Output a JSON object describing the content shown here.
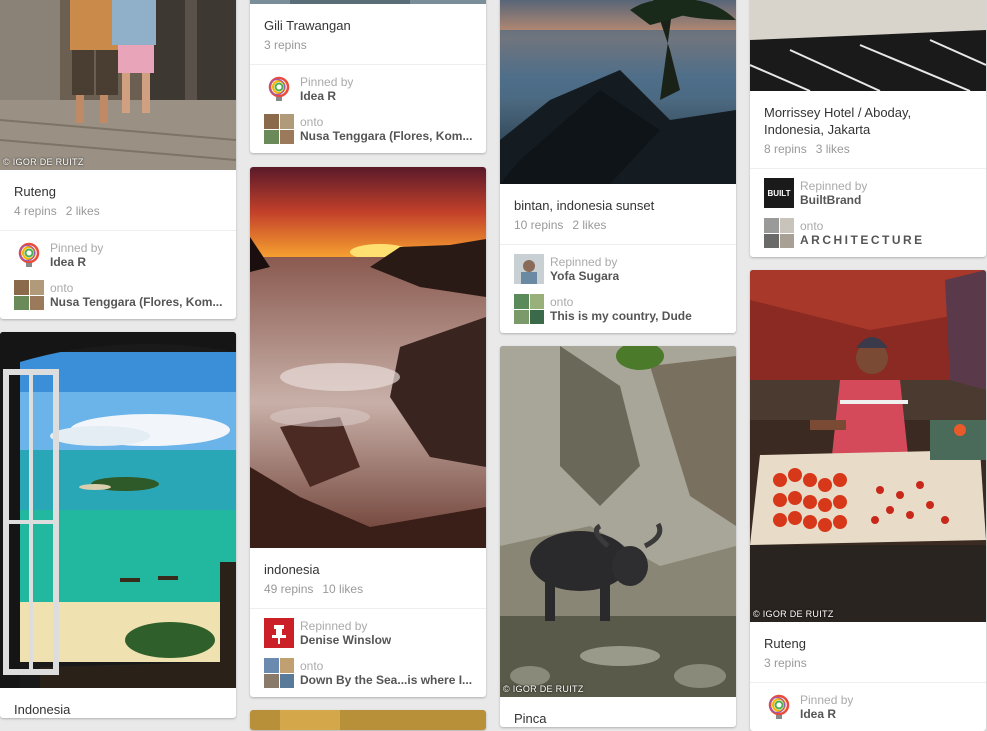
{
  "columns": [
    {
      "pins": [
        {
          "watermark": "© IGOR DE RUITZ",
          "description": "Ruteng",
          "repins": "4 repins",
          "likes": "2 likes",
          "attribution": {
            "label": "Pinned by",
            "name": "Idea R",
            "onto_label": "onto",
            "board": "Nusa Tenggara (Flores, Kom..."
          }
        },
        {
          "description": "Indonesia"
        }
      ]
    },
    {
      "pins": [
        {
          "description": "Gili Trawangan",
          "repins": "3 repins",
          "attribution": {
            "label": "Pinned by",
            "name": "Idea R",
            "onto_label": "onto",
            "board": "Nusa Tenggara (Flores, Kom..."
          }
        },
        {
          "description": "indonesia",
          "repins": "49 repins",
          "likes": "10 likes",
          "attribution": {
            "label": "Repinned by",
            "name": "Denise Winslow",
            "onto_label": "onto",
            "board": "Down By the Sea...is where I..."
          }
        }
      ]
    },
    {
      "pins": [
        {
          "description": "bintan, indonesia sunset",
          "repins": "10 repins",
          "likes": "2 likes",
          "attribution": {
            "label": "Repinned by",
            "name": "Yofa Sugara",
            "onto_label": "onto",
            "board": "This is my country, Dude"
          }
        },
        {
          "watermark": "© IGOR DE RUITZ",
          "description": "Pinca"
        }
      ]
    },
    {
      "pins": [
        {
          "description": "Morrissey Hotel / Aboday, Indonesia, Jakarta",
          "repins": "8 repins",
          "likes": "3 likes",
          "attribution": {
            "label": "Repinned by",
            "name": "BuiltBrand",
            "avatar_text": "BUILT",
            "onto_label": "onto",
            "board": "ARCHITECTURE"
          }
        },
        {
          "watermark": "© IGOR DE RUITZ",
          "description": "Ruteng",
          "repins": "3 repins",
          "attribution": {
            "label": "Pinned by",
            "name": "Idea R"
          }
        }
      ]
    }
  ],
  "colors": {
    "background": "#e9e9e9",
    "card": "#ffffff",
    "muted": "#999999",
    "name": "#555555",
    "pin_red": "#cb2027"
  }
}
